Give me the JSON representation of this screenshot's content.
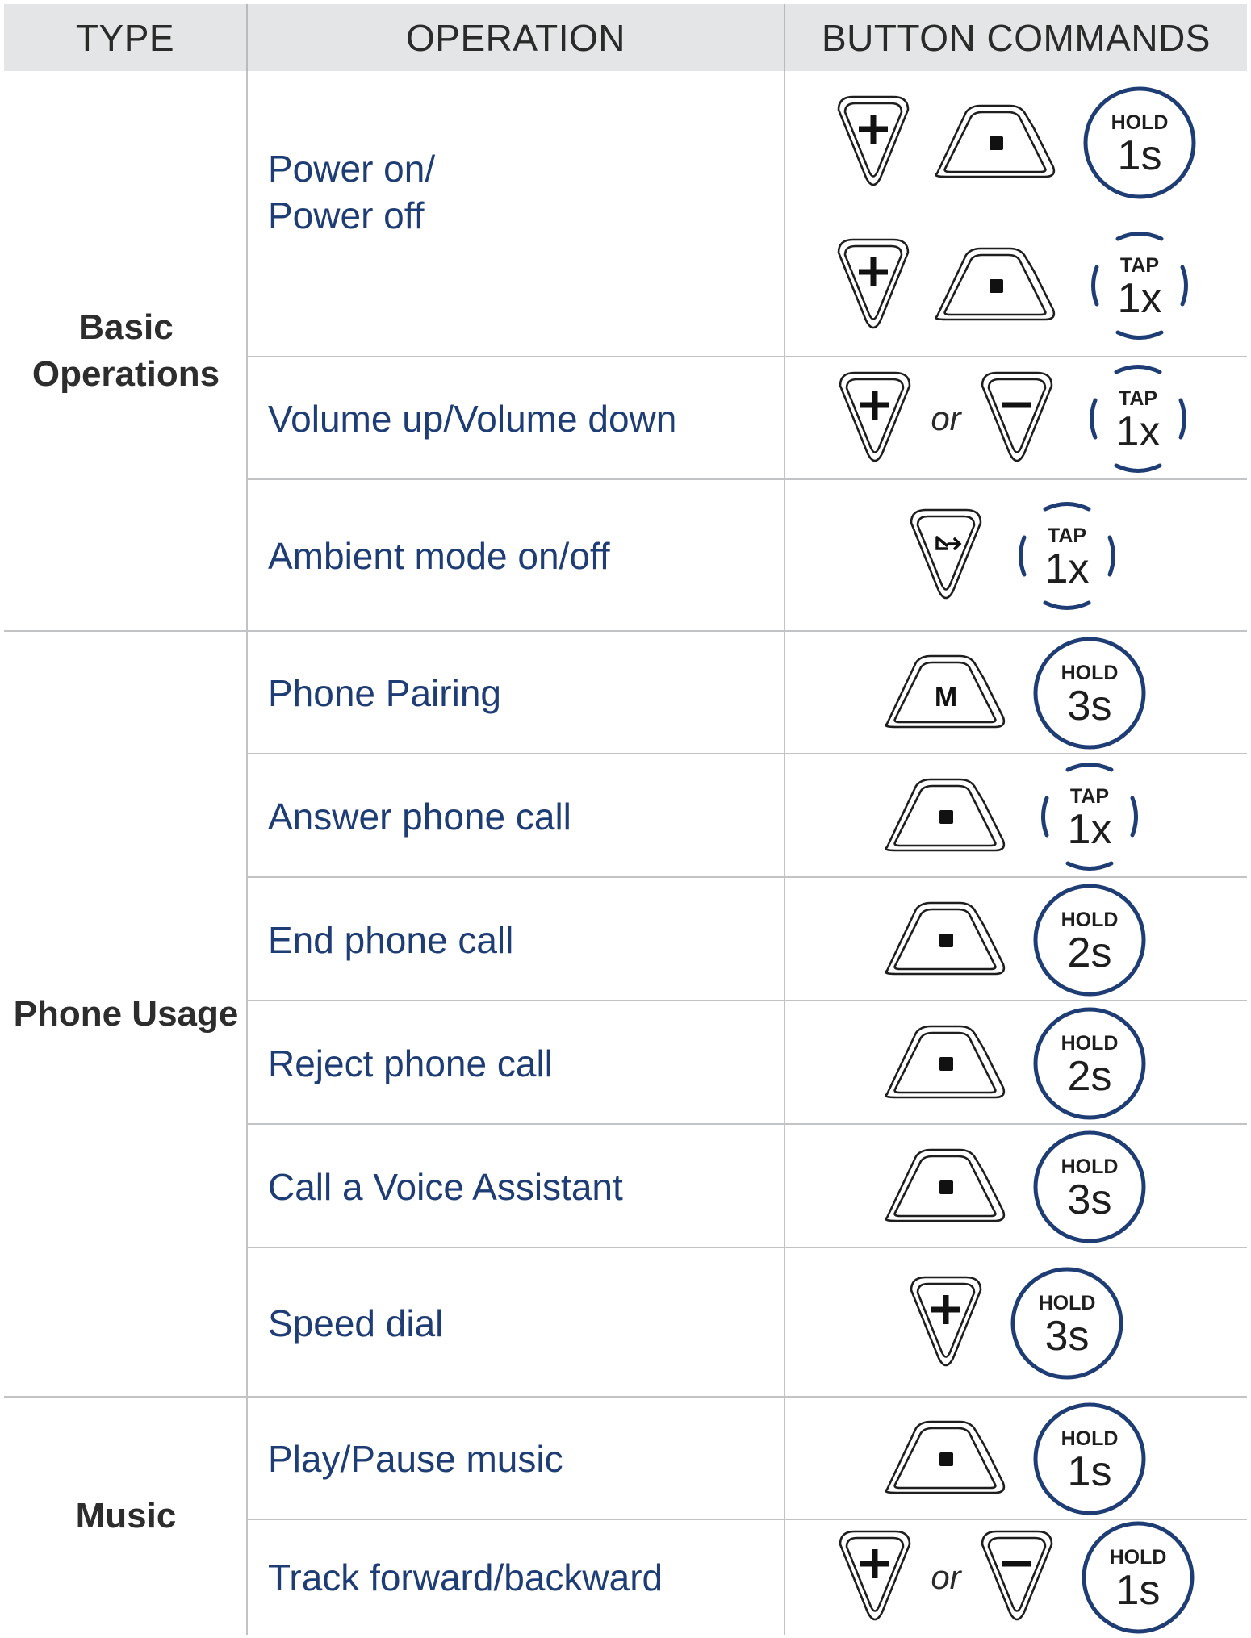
{
  "headers": {
    "type": "TYPE",
    "operation": "OPERATION",
    "commands": "BUTTON COMMANDS"
  },
  "or_label": "or",
  "colors": {
    "accent": "#1f3d75",
    "header_bg": "#e4e5e6",
    "grid": "#c2c3c5"
  },
  "groups": [
    {
      "label": "Basic Operations"
    },
    {
      "label": "Phone Usage"
    },
    {
      "label": "Music"
    }
  ],
  "rows": [
    {
      "operation": "Power on/ Power off",
      "commands": [
        {
          "buttons": [
            "plus-button-icon",
            "center-button-icon"
          ],
          "action": {
            "kind": "HOLD",
            "value": "1s"
          }
        },
        {
          "buttons": [
            "plus-button-icon",
            "center-button-icon"
          ],
          "action": {
            "kind": "TAP",
            "value": "1x"
          }
        }
      ]
    },
    {
      "operation": "Volume up/Volume down",
      "commands": [
        {
          "buttons": [
            "plus-button-icon",
            "or",
            "minus-button-icon"
          ],
          "action": {
            "kind": "TAP",
            "value": "1x"
          }
        }
      ]
    },
    {
      "operation": "Ambient mode on/off",
      "commands": [
        {
          "buttons": [
            "ambient-button-icon"
          ],
          "action": {
            "kind": "TAP",
            "value": "1x"
          }
        }
      ]
    },
    {
      "operation": "Phone Pairing",
      "commands": [
        {
          "buttons": [
            "m-button-icon"
          ],
          "action": {
            "kind": "HOLD",
            "value": "3s"
          }
        }
      ]
    },
    {
      "operation": "Answer phone call",
      "commands": [
        {
          "buttons": [
            "center-button-icon"
          ],
          "action": {
            "kind": "TAP",
            "value": "1x"
          }
        }
      ]
    },
    {
      "operation": "End phone call",
      "commands": [
        {
          "buttons": [
            "center-button-icon"
          ],
          "action": {
            "kind": "HOLD",
            "value": "2s"
          }
        }
      ]
    },
    {
      "operation": "Reject phone call",
      "commands": [
        {
          "buttons": [
            "center-button-icon"
          ],
          "action": {
            "kind": "HOLD",
            "value": "2s"
          }
        }
      ]
    },
    {
      "operation": "Call a Voice Assistant",
      "commands": [
        {
          "buttons": [
            "center-button-icon"
          ],
          "action": {
            "kind": "HOLD",
            "value": "3s"
          }
        }
      ]
    },
    {
      "operation": "Speed dial",
      "commands": [
        {
          "buttons": [
            "plus-button-icon"
          ],
          "action": {
            "kind": "HOLD",
            "value": "3s"
          }
        }
      ]
    },
    {
      "operation": "Play/Pause music",
      "commands": [
        {
          "buttons": [
            "center-button-icon"
          ],
          "action": {
            "kind": "HOLD",
            "value": "1s"
          }
        }
      ]
    },
    {
      "operation": "Track forward/backward",
      "commands": [
        {
          "buttons": [
            "plus-button-icon",
            "or",
            "minus-button-icon"
          ],
          "action": {
            "kind": "HOLD",
            "value": "1s"
          }
        }
      ]
    }
  ]
}
